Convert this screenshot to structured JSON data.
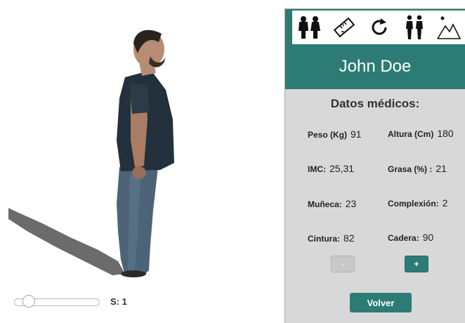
{
  "viewer": {
    "scale_label": "S: 1",
    "slider_value": 0.1
  },
  "panel": {
    "toolbar": {
      "icons": [
        "body-compare-icon",
        "ruler-icon",
        "rotate-icon",
        "body-front-back-icon",
        "terrain-icon"
      ]
    },
    "patient_name": "John Doe",
    "section_title": "Datos médicos:",
    "fields": {
      "peso": {
        "label": "Peso (Kg)",
        "value": "91"
      },
      "altura": {
        "label": "Altura (Cm)",
        "value": "180"
      },
      "imc": {
        "label": "IMC:",
        "value": "25,31"
      },
      "grasa": {
        "label": "Grasa (%) :",
        "value": "21"
      },
      "muneca": {
        "label": "Muñeca:",
        "value": "23"
      },
      "complexion": {
        "label": "Complexión:",
        "value": "2"
      },
      "cintura": {
        "label": "Cintura:",
        "value": "82"
      },
      "cadera": {
        "label": "Cadera:",
        "value": "90"
      }
    },
    "minus_label": "-",
    "plus_label": "+",
    "back_label": "Volver"
  },
  "colors": {
    "accent": "#2d7b75",
    "panel_bg": "#d8d8d8"
  }
}
